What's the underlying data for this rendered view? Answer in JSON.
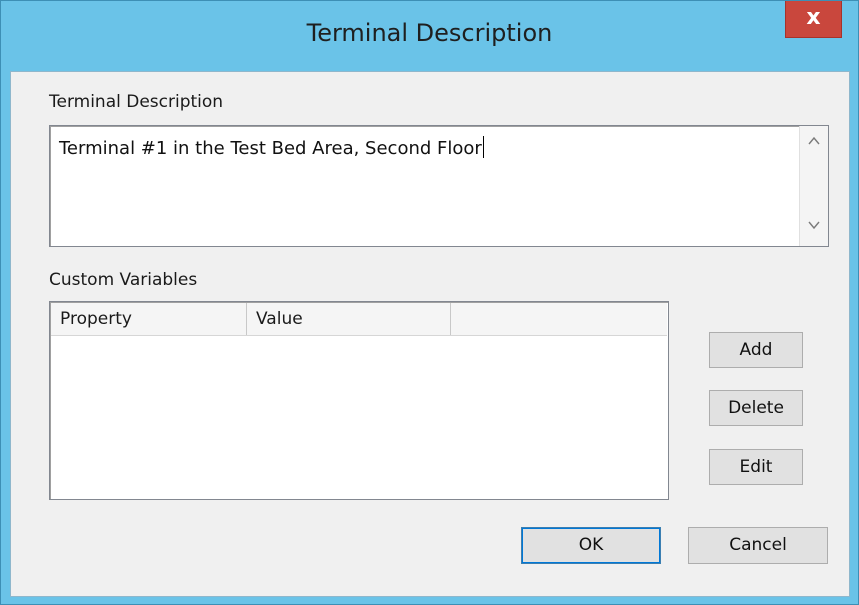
{
  "window": {
    "title": "Terminal Description",
    "close_glyph": "x"
  },
  "description": {
    "label": "Terminal Description",
    "value": "Terminal #1 in the Test Bed Area, Second Floor",
    "scroll_up_glyph": "^",
    "scroll_down_glyph": "v"
  },
  "custom_variables": {
    "label": "Custom Variables",
    "columns": [
      "Property",
      "Value",
      ""
    ]
  },
  "buttons": {
    "add": "Add",
    "delete": "Delete",
    "edit": "Edit",
    "ok": "OK",
    "cancel": "Cancel"
  },
  "colors": {
    "titlebar": "#6ac3e8",
    "close": "#c9473d",
    "dialog_bg": "#f0f0f0"
  }
}
